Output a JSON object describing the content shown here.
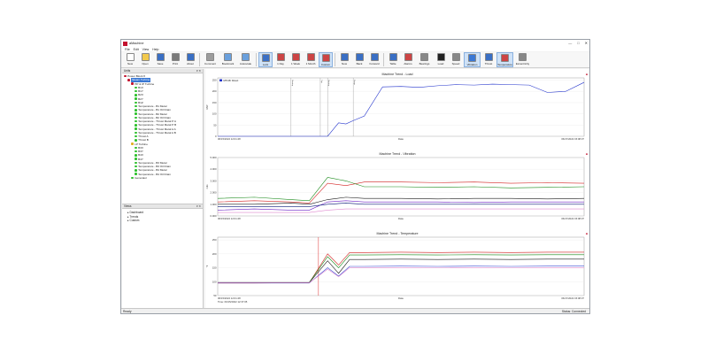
{
  "window": {
    "title": "aMachine",
    "controls": [
      "—",
      "□",
      "✕"
    ]
  },
  "menu": [
    "File",
    "Edit",
    "View",
    "Help"
  ],
  "toolbar": {
    "buttons": [
      {
        "label": "New",
        "color": "#ffffff"
      },
      {
        "label": "Open",
        "color": "#f2c94c"
      },
      {
        "label": "Save",
        "color": "#3a6fc4"
      },
      {
        "label": "Print",
        "color": "#7a7a7a"
      },
      {
        "label": "About",
        "color": "#3a6fc4"
      },
      {
        "label": "Comment",
        "color": "#9c9c9c"
      },
      {
        "label": "Bookmark",
        "color": "#6aa0dd"
      },
      {
        "label": "Autoscale",
        "color": "#6aa0dd"
      },
      {
        "label": "Lock",
        "color": "#3a6fc4"
      },
      {
        "label": "1 Day",
        "color": "#c44"
      },
      {
        "label": "1 Week",
        "color": "#c44"
      },
      {
        "label": "1 Month",
        "color": "#c44"
      },
      {
        "label": "Custom",
        "color": "#c44"
      },
      {
        "label": "Now",
        "color": "#3a6fc4"
      },
      {
        "label": "Back",
        "color": "#3a6fc4"
      },
      {
        "label": "Forward",
        "color": "#3a6fc4"
      },
      {
        "label": "Table",
        "color": "#3a6fc4"
      },
      {
        "label": "Alarms",
        "color": "#c44"
      },
      {
        "label": "Bearings",
        "color": "#888"
      },
      {
        "label": "Load",
        "color": "#222"
      },
      {
        "label": "Speed",
        "color": "#888"
      },
      {
        "label": "Vibration",
        "color": "#3a78d4"
      },
      {
        "label": "Thrust",
        "color": "#3a6fc4"
      },
      {
        "label": "Temperature",
        "color": "#c44"
      },
      {
        "label": "Eccentricity",
        "color": "#888"
      }
    ]
  },
  "tree": {
    "header": "Units",
    "items": [
      {
        "label": "Power Block 8",
        "level": 0,
        "color": "#c3122e"
      },
      {
        "label": "Steam Turbine",
        "level": 1,
        "color": "#c3122e",
        "selected": true
      },
      {
        "label": "HP & IP Turbine",
        "level": 2,
        "color": "#c3122e"
      },
      {
        "label": "B1X",
        "level": 3,
        "color": "#2ec02e"
      },
      {
        "label": "B1Y",
        "level": 3,
        "color": "#2ec02e"
      },
      {
        "label": "B2X",
        "level": 3,
        "color": "#2ec02e"
      },
      {
        "label": "B2Y",
        "level": 3,
        "color": "#2ec02e"
      },
      {
        "label": "B1Z",
        "level": 3,
        "color": "#2ec02e"
      },
      {
        "label": "Temperature - B1 Metal",
        "level": 3,
        "color": "#2ec02e"
      },
      {
        "label": "Temperature - B1 Oil Drain",
        "level": 3,
        "color": "#2ec02e"
      },
      {
        "label": "Temperature - B2 Metal",
        "level": 3,
        "color": "#2ec02e"
      },
      {
        "label": "Temperature - B2 Oil Drain",
        "level": 3,
        "color": "#2ec02e"
      },
      {
        "label": "Temperature - Thrust Metal P A",
        "level": 3,
        "color": "#2ec02e"
      },
      {
        "label": "Temperature - Thrust Metal P B",
        "level": 3,
        "color": "#2ec02e"
      },
      {
        "label": "Temperature - Thrust Metal A A",
        "level": 3,
        "color": "#2ec02e"
      },
      {
        "label": "Temperature - Thrust Metal A B",
        "level": 3,
        "color": "#2ec02e"
      },
      {
        "label": "Thrust A",
        "level": 3,
        "color": "#2ec02e"
      },
      {
        "label": "Thrust B",
        "level": 3,
        "color": "#2ec02e"
      },
      {
        "label": "LP Turbine",
        "level": 2,
        "color": "#e0b020"
      },
      {
        "label": "B3X",
        "level": 3,
        "color": "#2ec02e"
      },
      {
        "label": "B3Y",
        "level": 3,
        "color": "#2ec02e"
      },
      {
        "label": "B4X",
        "level": 3,
        "color": "#2ec02e"
      },
      {
        "label": "B4Y",
        "level": 3,
        "color": "#2ec02e"
      },
      {
        "label": "Temperature - B3 Metal",
        "level": 3,
        "color": "#2ec02e"
      },
      {
        "label": "Temperature - B3 Oil Drain",
        "level": 3,
        "color": "#2ec02e"
      },
      {
        "label": "Temperature - B4 Metal",
        "level": 3,
        "color": "#2ec02e"
      },
      {
        "label": "Temperature - B4 Oil Drain",
        "level": 3,
        "color": "#2ec02e"
      },
      {
        "label": "Generator",
        "level": 2,
        "color": "#2ec02e"
      }
    ]
  },
  "views": {
    "header": "Views",
    "items": [
      "Dashboard",
      "Trends",
      "Custom"
    ]
  },
  "charts": [
    {
      "title": "Machine Trend - Load",
      "xlabel": "Date",
      "ylabel": "MW",
      "x_start": "06/15/2022 12:01:48",
      "x_end": "06/17/2022 15:08:37",
      "legend": [
        "MTrd8: Direct"
      ],
      "yticks": [
        "0",
        "50",
        "100",
        "150",
        "200",
        "250"
      ],
      "ylim": [
        0,
        260
      ],
      "markers": [
        "Startup",
        "Trip",
        "Startup",
        "Ramp"
      ],
      "chart_data": {
        "type": "line",
        "x": [
          0,
          0.05,
          0.1,
          0.15,
          0.2,
          0.25,
          0.3,
          0.32,
          0.33,
          0.35,
          0.37,
          0.4,
          0.45,
          0.5,
          0.55,
          0.6,
          0.65,
          0.7,
          0.75,
          0.8,
          0.85,
          0.9,
          0.95,
          1.0
        ],
        "series": [
          {
            "name": "MTrd8: Direct",
            "color": "#2233cc",
            "values": [
              0,
              0,
              0,
              0,
              0,
              0,
              0,
              40,
              60,
              55,
              70,
              90,
              220,
              222,
              218,
              225,
              230,
              228,
              232,
              230,
              228,
              195,
              200,
              240
            ]
          }
        ]
      }
    },
    {
      "title": "Machine Trend - Vibration",
      "xlabel": "Date",
      "ylabel": "mils",
      "x_start": "06/15/2022 12:01:48",
      "x_end": "06/17/2022 15:08:37",
      "yticks": [
        "0.000",
        "1.000",
        "2.000",
        "3.000",
        "4.000",
        "5.000"
      ],
      "ylim": [
        0,
        5
      ],
      "chart_data": {
        "type": "line",
        "x": [
          0,
          0.1,
          0.2,
          0.25,
          0.3,
          0.35,
          0.4,
          0.5,
          0.6,
          0.7,
          0.8,
          0.9,
          1.0
        ],
        "series": [
          {
            "name": "B1X",
            "color": "#d32222",
            "values": [
              1.2,
              1.3,
              1.2,
              1.1,
              2.8,
              2.6,
              2.9,
              2.9,
              2.85,
              2.9,
              2.8,
              2.85,
              2.8
            ]
          },
          {
            "name": "B1Y",
            "color": "#1a8a1a",
            "values": [
              1.5,
              1.6,
              1.4,
              1.3,
              3.3,
              3.0,
              2.5,
              2.5,
              2.45,
              2.5,
              2.4,
              2.45,
              2.5
            ]
          },
          {
            "name": "B2X",
            "color": "#1a1a1a",
            "values": [
              1.0,
              1.0,
              1.1,
              1.0,
              1.4,
              1.6,
              1.5,
              1.5,
              1.45,
              1.5,
              1.5,
              1.45,
              1.5
            ]
          },
          {
            "name": "B2Y",
            "color": "#6a1fc4",
            "values": [
              0.5,
              0.6,
              0.5,
              0.5,
              1.2,
              1.3,
              1.2,
              1.2,
              1.2,
              1.15,
              1.2,
              1.2,
              1.2
            ]
          },
          {
            "name": "B3X",
            "color": "#0a1a7a",
            "values": [
              0.8,
              0.8,
              0.8,
              0.8,
              1.0,
              1.1,
              1.0,
              1.0,
              1.0,
              1.0,
              1.0,
              1.0,
              1.0
            ]
          },
          {
            "name": "B4X",
            "color": "#e08ad0",
            "values": [
              0.3,
              0.3,
              0.3,
              0.3,
              0.5,
              0.6,
              0.6,
              0.6,
              0.6,
              0.6,
              0.6,
              0.6,
              0.6
            ]
          }
        ]
      }
    },
    {
      "title": "Machine Trend - Temperature",
      "xlabel": "Date",
      "ylabel": "°F",
      "x_start": "06/15/2022 12:01:48",
      "x_end": "06/17/2022 15:08:37",
      "cursor_time": "Time: 06/15/2022 12:37:05",
      "yticks": [
        "50",
        "100",
        "150",
        "200",
        "250"
      ],
      "ylim": [
        50,
        260
      ],
      "chart_data": {
        "type": "line",
        "x": [
          0,
          0.1,
          0.2,
          0.25,
          0.3,
          0.33,
          0.36,
          0.4,
          0.5,
          0.6,
          0.7,
          0.8,
          0.9,
          1.0
        ],
        "series": [
          {
            "name": "Temp A",
            "color": "#d32222",
            "values": [
              95,
              95,
              96,
              96,
              200,
              160,
              205,
              205,
              206,
              205,
              206,
              205,
              206,
              206
            ]
          },
          {
            "name": "Temp B",
            "color": "#1a8a1a",
            "values": [
              96,
              96,
              96,
              97,
              190,
              150,
              196,
              196,
              197,
              196,
              197,
              196,
              197,
              197
            ]
          },
          {
            "name": "Temp C",
            "color": "#1a1a1a",
            "values": [
              97,
              97,
              97,
              97,
              175,
              130,
              180,
              180,
              181,
              180,
              181,
              180,
              181,
              181
            ]
          },
          {
            "name": "Temp D",
            "color": "#3a4ad4",
            "values": [
              95,
              95,
              95,
              95,
              150,
              120,
              155,
              155,
              156,
              155,
              156,
              155,
              156,
              156
            ]
          },
          {
            "name": "Temp E",
            "color": "#e08ad0",
            "values": [
              96,
              96,
              96,
              96,
              145,
              118,
              150,
              150,
              150,
              151,
              150,
              151,
              150,
              150
            ]
          }
        ]
      }
    }
  ],
  "status": {
    "left": "Ready",
    "right": "Status: Connected"
  }
}
